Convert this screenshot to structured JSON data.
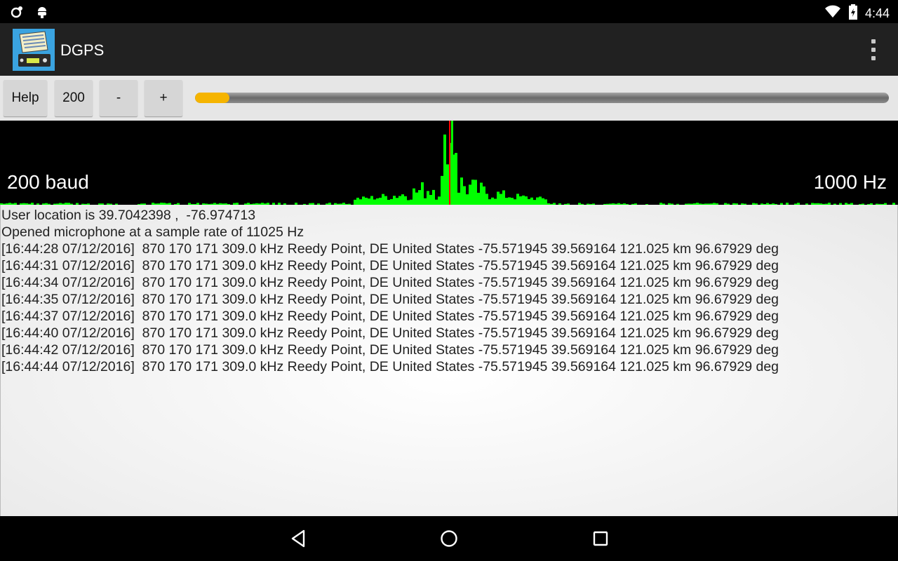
{
  "status_bar": {
    "time": "4:44",
    "left_icons": [
      "sync-icon",
      "android-debug-icon"
    ],
    "right_icons": [
      "wifi-icon",
      "battery-icon"
    ]
  },
  "action_bar": {
    "title": "DGPS",
    "app_icon": "dgps-app-icon",
    "overflow_icon": "overflow-menu-icon"
  },
  "controls": {
    "help_label": "Help",
    "baud_label": "200",
    "minus_label": "-",
    "plus_label": "+",
    "slider_fraction": 0.05,
    "slider_color": "#f5b400"
  },
  "spectrum": {
    "left_label": "200 baud",
    "right_label": "1000 Hz",
    "bar_color": "#00ff00",
    "marker_color": "#ff0000",
    "marker_fraction": 0.5
  },
  "log": {
    "lines": [
      "User location is 39.7042398 ,  -76.974713",
      "Opened microphone at a sample rate of 11025 Hz",
      "[16:44:28 07/12/2016]  870 170 171 309.0 kHz Reedy Point, DE United States -75.571945 39.569164 121.025 km 96.67929 deg",
      "[16:44:31 07/12/2016]  870 170 171 309.0 kHz Reedy Point, DE United States -75.571945 39.569164 121.025 km 96.67929 deg",
      "[16:44:34 07/12/2016]  870 170 171 309.0 kHz Reedy Point, DE United States -75.571945 39.569164 121.025 km 96.67929 deg",
      "[16:44:35 07/12/2016]  870 170 171 309.0 kHz Reedy Point, DE United States -75.571945 39.569164 121.025 km 96.67929 deg",
      "[16:44:37 07/12/2016]  870 170 171 309.0 kHz Reedy Point, DE United States -75.571945 39.569164 121.025 km 96.67929 deg",
      "[16:44:40 07/12/2016]  870 170 171 309.0 kHz Reedy Point, DE United States -75.571945 39.569164 121.025 km 96.67929 deg",
      "[16:44:42 07/12/2016]  870 170 171 309.0 kHz Reedy Point, DE United States -75.571945 39.569164 121.025 km 96.67929 deg",
      "[16:44:44 07/12/2016]  870 170 171 309.0 kHz Reedy Point, DE United States -75.571945 39.569164 121.025 km 96.67929 deg"
    ]
  },
  "nav_bar": {
    "icons": [
      "back-icon",
      "home-icon",
      "recents-icon"
    ]
  }
}
